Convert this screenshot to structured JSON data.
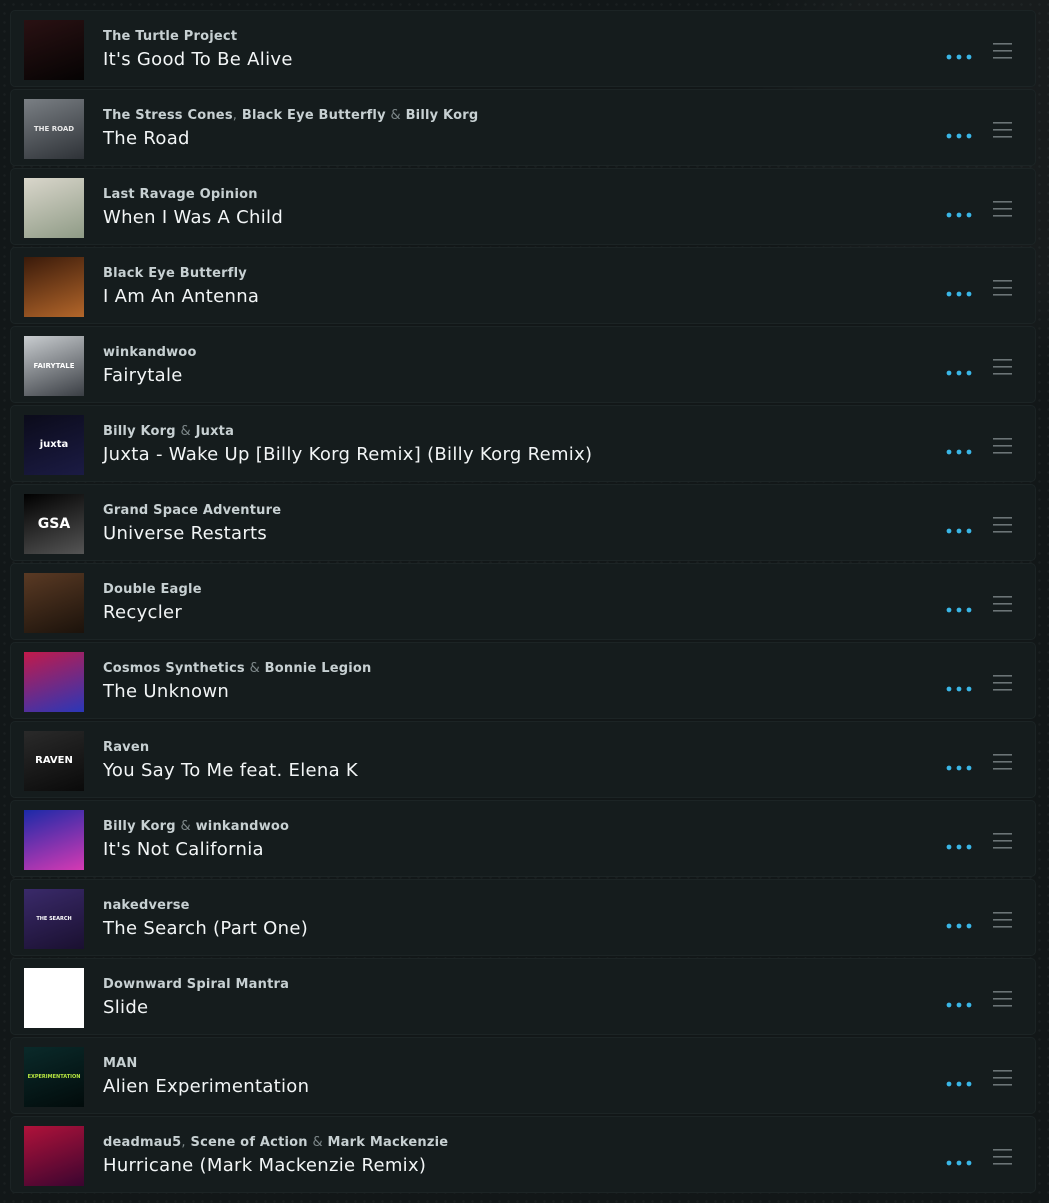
{
  "icons": {
    "more": "ellipsis-icon",
    "drag": "drag-handle-icon"
  },
  "colors": {
    "background": "#121718",
    "row": "#151c1d",
    "accent": "#3ab6e6",
    "handle": "#6b7476"
  },
  "tracks": [
    {
      "artists": [
        "The Turtle Project"
      ],
      "separators": [],
      "title": "It's Good To Be Alive",
      "cover": {
        "label": "",
        "bg": "#2a1113",
        "bg2": "#050303",
        "color": "#ffffff"
      }
    },
    {
      "artists": [
        "The Stress Cones",
        "Black Eye Butterfly",
        "Billy Korg"
      ],
      "separators": [
        ",",
        "&"
      ],
      "title": "The Road",
      "cover": {
        "label": "THE ROAD",
        "bg": "#7a7f84",
        "bg2": "#2e3237",
        "color": "#e8e8e8"
      }
    },
    {
      "artists": [
        "Last Ravage Opinion"
      ],
      "separators": [],
      "title": "When I Was A Child",
      "cover": {
        "label": "",
        "bg": "#d9d6cb",
        "bg2": "#8f9b86",
        "color": "#000000"
      }
    },
    {
      "artists": [
        "Black Eye Butterfly"
      ],
      "separators": [],
      "title": "I Am An Antenna",
      "cover": {
        "label": "",
        "bg": "#3a1a0a",
        "bg2": "#b3662a",
        "color": "#ffffff"
      }
    },
    {
      "artists": [
        "winkandwoo"
      ],
      "separators": [],
      "title": "Fairytale",
      "cover": {
        "label": "FAIRYTALE",
        "bg": "#c9cdd0",
        "bg2": "#3a3e44",
        "color": "#ffffff"
      }
    },
    {
      "artists": [
        "Billy Korg",
        "Juxta"
      ],
      "separators": [
        "&"
      ],
      "title": "Juxta - Wake Up [Billy Korg Remix] (Billy Korg Remix)",
      "cover": {
        "label": "juxta",
        "bg": "#0b0b1a",
        "bg2": "#1b1b44",
        "color": "#ffffff"
      }
    },
    {
      "artists": [
        "Grand Space Adventure"
      ],
      "separators": [],
      "title": "Universe Restarts",
      "cover": {
        "label": "GSA",
        "bg": "#000000",
        "bg2": "#555555",
        "color": "#ffffff"
      }
    },
    {
      "artists": [
        "Double Eagle"
      ],
      "separators": [],
      "title": "Recycler",
      "cover": {
        "label": "",
        "bg": "#5a3a24",
        "bg2": "#1b120b",
        "color": "#ffffff"
      }
    },
    {
      "artists": [
        "Cosmos Synthetics",
        "Bonnie Legion"
      ],
      "separators": [
        "&"
      ],
      "title": "The Unknown",
      "cover": {
        "label": "",
        "bg": "#c21a4a",
        "bg2": "#2a37b8",
        "color": "#ffffff"
      }
    },
    {
      "artists": [
        "Raven"
      ],
      "separators": [],
      "title": "You Say To Me feat. Elena K",
      "cover": {
        "label": "RAVEN",
        "bg": "#2a2a2a",
        "bg2": "#0a0a0a",
        "color": "#ffffff"
      }
    },
    {
      "artists": [
        "Billy Korg",
        "winkandwoo"
      ],
      "separators": [
        "&"
      ],
      "title": "It's Not California",
      "cover": {
        "label": "",
        "bg": "#1b2aa8",
        "bg2": "#d63ab3",
        "color": "#ffffff"
      }
    },
    {
      "artists": [
        "nakedverse"
      ],
      "separators": [],
      "title": "The Search (Part One)",
      "cover": {
        "label": "THE SEARCH",
        "bg": "#3a2a6a",
        "bg2": "#1a1030",
        "color": "#ffffff"
      }
    },
    {
      "artists": [
        "Downward Spiral Mantra"
      ],
      "separators": [],
      "title": "Slide",
      "cover": {
        "label": "",
        "bg": "#ffffff",
        "bg2": "#ffffff",
        "color": "#000000"
      }
    },
    {
      "artists": [
        "MAN"
      ],
      "separators": [],
      "title": "Alien Experimentation",
      "cover": {
        "label": "EXPERIMENTATION",
        "bg": "#0a2a2a",
        "bg2": "#020b0b",
        "color": "#b7e640"
      }
    },
    {
      "artists": [
        "deadmau5",
        "Scene of Action",
        "Mark Mackenzie"
      ],
      "separators": [
        ",",
        "&"
      ],
      "title": "Hurricane (Mark Mackenzie Remix)",
      "cover": {
        "label": "",
        "bg": "#b0123a",
        "bg2": "#3a0530",
        "color": "#ffffff"
      }
    }
  ]
}
